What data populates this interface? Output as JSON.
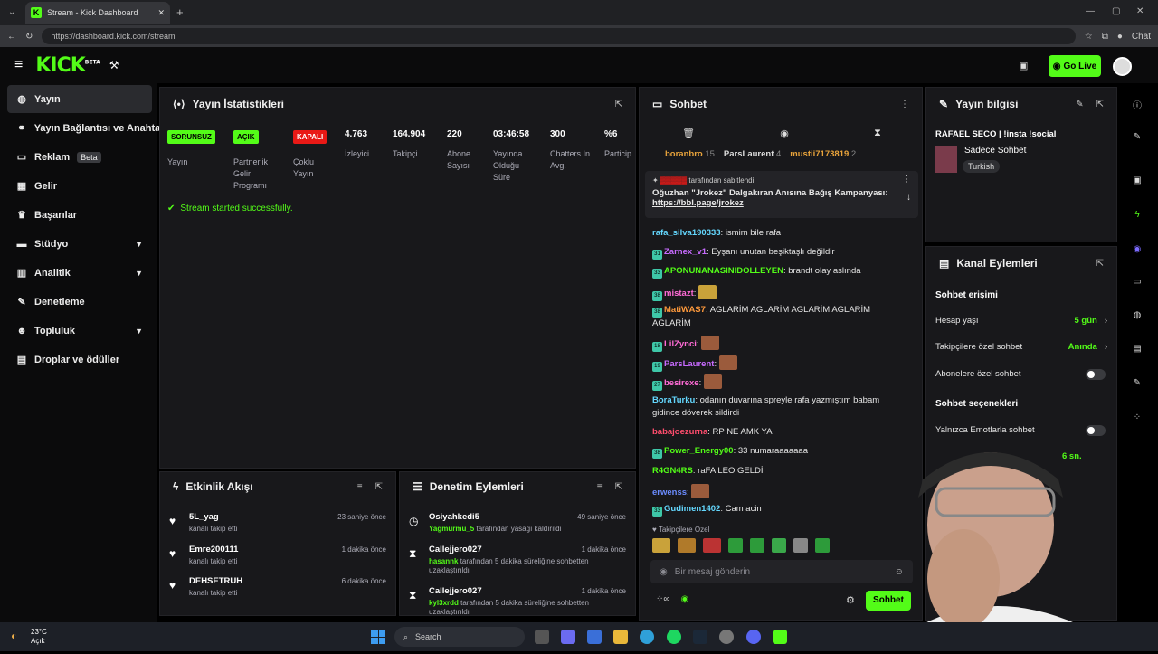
{
  "browser": {
    "tab_title": "Stream - Kick Dashboard",
    "url": "https://dashboard.kick.com/stream",
    "chat_label": "Chat"
  },
  "topbar": {
    "logo": "KICK",
    "logo_sup": "BETA",
    "go_live": "Go Live"
  },
  "sidebar": {
    "items": [
      {
        "label": "Yayın",
        "icon": "broadcast-icon"
      },
      {
        "label": "Yayın Bağlantısı ve Anahtar",
        "icon": "link-icon"
      },
      {
        "label": "Reklam",
        "icon": "ad-icon",
        "badge": "Beta"
      },
      {
        "label": "Gelir",
        "icon": "revenue-icon"
      },
      {
        "label": "Başarılar",
        "icon": "trophy-icon"
      },
      {
        "label": "Stüdyo",
        "icon": "studio-icon"
      },
      {
        "label": "Analitik",
        "icon": "chart-icon"
      },
      {
        "label": "Denetleme",
        "icon": "wrench-icon"
      },
      {
        "label": "Topluluk",
        "icon": "community-icon"
      },
      {
        "label": "Droplar ve ödüller",
        "icon": "gift-icon"
      }
    ]
  },
  "stats": {
    "title": "Yayın İstatistikleri",
    "badges": [
      {
        "badge": "SORUNSUZ",
        "label": "Yayın",
        "color": "#53fc18"
      },
      {
        "badge": "AÇIK",
        "label": "Partnerlik Gelir Programı",
        "color": "#53fc18"
      },
      {
        "badge": "KAPALI",
        "label": "Çoklu Yayın",
        "color": "#e91916"
      }
    ],
    "metrics": [
      {
        "value": "4.763",
        "label": "İzleyici"
      },
      {
        "value": "164.904",
        "label": "Takipçi"
      },
      {
        "value": "220",
        "label": "Abone Sayısı"
      },
      {
        "value": "03:46:58",
        "label": "Yayında Olduğu Süre"
      },
      {
        "value": "300",
        "label": "Chatters In Avg."
      },
      {
        "value": "%6",
        "label": "Particip"
      }
    ],
    "success": "Stream started successfully."
  },
  "activity": {
    "title": "Etkinlik Akışı",
    "rows": [
      {
        "name": "5L_yag",
        "sub": "kanalı takip etti",
        "time": "23 saniye önce"
      },
      {
        "name": "Emre200111",
        "sub": "kanalı takip etti",
        "time": "1 dakika önce"
      },
      {
        "name": "DEHSETRUH",
        "sub": "kanalı takip etti",
        "time": "6 dakika önce"
      }
    ]
  },
  "moderation": {
    "title": "Denetim Eylemleri",
    "rows": [
      {
        "name": "Osiyahkedi5",
        "actor": "Yagmurmu_5",
        "sub": " tarafından yasağı kaldırıldı",
        "time": "49 saniye önce"
      },
      {
        "name": "Callejjero027",
        "actor": "hasannk",
        "sub": " tarafından 5 dakika süreliğine sohbetten uzaklaştırıldı",
        "time": "1 dakika önce"
      },
      {
        "name": "Callejjero027",
        "actor": "kyl3xrdd",
        "sub": " tarafından 5 dakika süreliğine sohbetten uzaklaştırıldı",
        "time": "1 dakika önce"
      }
    ]
  },
  "chat": {
    "title": "Sohbet",
    "top_gifters": [
      {
        "name": "boranbro",
        "count": "15",
        "color": "#e8a33b"
      },
      {
        "name": "ParsLaurent",
        "count": "4",
        "color": "#dcdcdc"
      },
      {
        "name": "mustii7173819",
        "count": "2",
        "color": "#e8a33b"
      }
    ],
    "pinned_by": "tarafından sabitlendi",
    "pinned_text": "Oğuzhan \"Jrokez\" Dalgakıran Anısına Bağış Kampanyası:",
    "pinned_link": "https://bbl.page/jrokez",
    "messages": [
      {
        "user": "rafa_silva190333",
        "color": "#64d8ff",
        "text": ": ismim bile rafa"
      },
      {
        "user": "Zarnex_v1",
        "color": "#c76bff",
        "text": ": Eyşanı unutan beşiktaşlı değildir"
      },
      {
        "user": "APONUNANASINIDOLLEYEN",
        "color": "#53fc18",
        "text": ": brandt olay aslında"
      },
      {
        "user": "mistazt",
        "color": "#ff6bd6",
        "text": ":"
      },
      {
        "user": "MatiWAS7",
        "color": "#ff9a3c",
        "text": ": AGLARİM AGLARİM AGLARİM AGLARİM AGLARİM"
      },
      {
        "user": "LilZynci",
        "color": "#ff6bd6",
        "text": ":"
      },
      {
        "user": "ParsLaurent",
        "color": "#c76bff",
        "text": ":"
      },
      {
        "user": "besirexe",
        "color": "#ff6bd6",
        "text": ":"
      },
      {
        "user": "BoraTurku",
        "color": "#64d8ff",
        "text": ": odanın duvarına spreyle rafa yazmıştım babam gidince döverek sildirdi"
      },
      {
        "user": "babajoezurna",
        "color": "#ff4d6d",
        "text": ": RP NE AMK YA"
      },
      {
        "user": "Power_Energy00",
        "color": "#53fc18",
        "text": ": 33 numaraaaaaaa"
      },
      {
        "user": "R4GN4RS",
        "color": "#53fc18",
        "text": ": raFA LEO GELDİ"
      },
      {
        "user": "erwenss",
        "color": "#6b8cff",
        "text": ":"
      },
      {
        "user": "Gudimen1402",
        "color": "#64d8ff",
        "text": ": Cam acin"
      }
    ],
    "followers_only": "Takipçilere Özel",
    "placeholder": "Bir mesaj gönderin",
    "send": "Sohbet"
  },
  "stream_info": {
    "title": "Yayın bilgisi",
    "stream_title": "RAFAEL SECO | !insta !social",
    "category": "Sadece Sohbet",
    "tag": "Turkish"
  },
  "channel_actions": {
    "title": "Kanal Eylemleri",
    "access_heading": "Sohbet erişimi",
    "account_age": "Hesap yaşı",
    "account_age_val": "5 gün",
    "followers_chat": "Takipçilere özel sohbet",
    "followers_chat_val": "Anında",
    "subs_chat": "Abonelere özel sohbet",
    "options_heading": "Sohbet seçenekleri",
    "emote_only": "Yalnızca Emotlarla sohbet",
    "slow_val": "6 sn."
  },
  "taskbar": {
    "temp": "23°C",
    "weather": "Açık",
    "search": "Search"
  }
}
